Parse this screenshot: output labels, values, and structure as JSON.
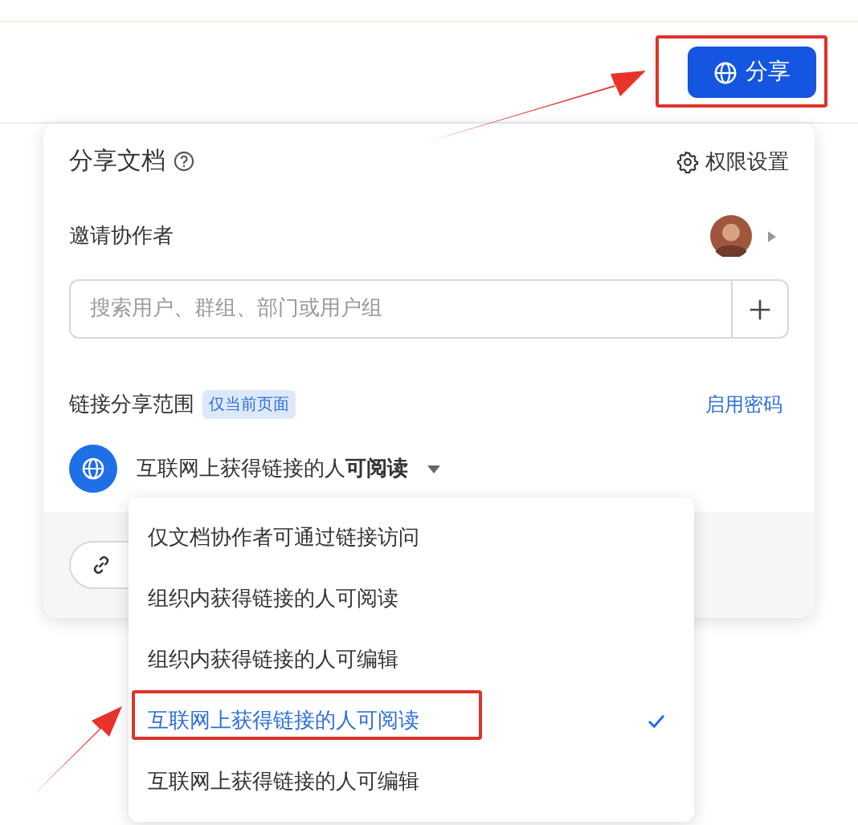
{
  "toolbar": {
    "share_button": "分享"
  },
  "dialog": {
    "title": "分享文档",
    "settings_link": "权限设置",
    "invite_label": "邀请协作者",
    "search": {
      "placeholder": "搜索用户、群组、部门或用户组"
    },
    "link_scope_label": "链接分享范围",
    "scope_tag": "仅当前页面",
    "password_link": "启用密码",
    "current_permission": "互联网上获得链接的人**可阅读**"
  },
  "dropdown": {
    "options": [
      {
        "label": "仅文档协作者可通过链接访问",
        "selected": false
      },
      {
        "label": "组织内获得链接的人可阅读",
        "selected": false
      },
      {
        "label": "组织内获得链接的人可编辑",
        "selected": false
      },
      {
        "label": "互联网上获得链接的人可阅读",
        "selected": true
      },
      {
        "label": "互联网上获得链接的人可编辑",
        "selected": false
      }
    ]
  }
}
